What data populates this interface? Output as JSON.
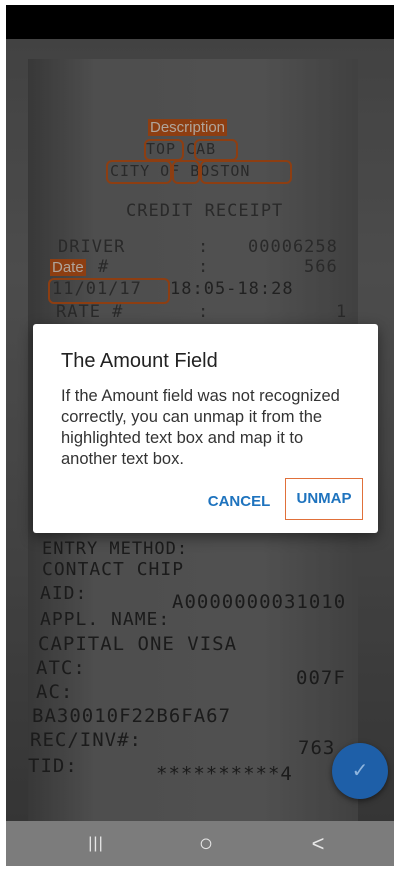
{
  "receipt": {
    "lines": {
      "r1": "TOP CAB",
      "r2": "CITY OF BOSTON",
      "r3": "CREDIT RECEIPT",
      "r4a": "DRIVER",
      "r4b": ":",
      "r4c": "00006258",
      "r5a": "#",
      "r5b": ":",
      "r5c": "566",
      "r6a": "11/01/17",
      "r6b": "18:05-18:28",
      "r7a": "RATE #",
      "r7b": ":",
      "r7c": "1",
      "r8": "ENTRY METHOD:",
      "r9": "CONTACT CHIP",
      "r10a": "AID:",
      "r10b": "A0000000031010",
      "r11": "APPL. NAME:",
      "r12": "CAPITAL ONE VISA",
      "r13a": "ATC:",
      "r13b": "007F",
      "r14": "AC:",
      "r15": "BA30010F22B6FA67",
      "r16a": "REC/INV#:",
      "r16b": "763",
      "r17a": "TID:",
      "r17b": "**********4"
    },
    "annotations": {
      "description_label": "Description",
      "date_label": "Date"
    },
    "highlight_color": "#c4571a"
  },
  "dialog": {
    "title": "The Amount Field",
    "message": "If the Amount field was not recognized correctly, you can unmap it from the highlighted text box and map it to another text box.",
    "cancel_label": "CANCEL",
    "unmap_label": "UNMAP",
    "accent_color": "#1e73be"
  },
  "fab": {
    "icon": "check-icon",
    "glyph": "✓"
  },
  "navbar": {
    "recents_glyph": "|||",
    "home_glyph": "○",
    "back_glyph": "<"
  }
}
